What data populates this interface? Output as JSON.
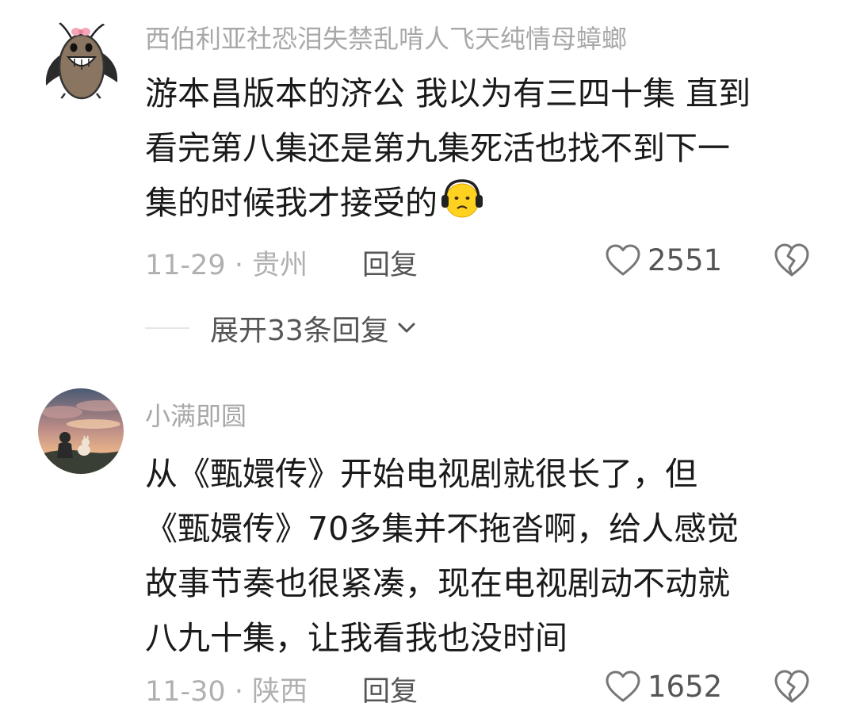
{
  "comments": [
    {
      "username": "西伯利亚社恐泪失禁乱啃人飞天纯情母蟑螂",
      "avatar_icon": "cockroach-cartoon-avatar",
      "content_lines": [
        "游本昌版本的济公 我以为有三四十集 直到",
        "看完第八集还是第九集死活也找不到下一",
        "集的时候我才接受的"
      ],
      "emoji_icon": "headphones-sad-face-emoji",
      "date": "11-29",
      "location": "贵州",
      "reply_label": "回复",
      "like_count": "2551",
      "expand_label": "展开33条回复"
    },
    {
      "username": "小满即圆",
      "avatar_icon": "sunset-child-dog-avatar",
      "content_lines": [
        "从《甄嬛传》开始电视剧就很长了，但",
        "《甄嬛传》70多集并不拖沓啊，给人感觉",
        "故事节奏也很紧凑，现在电视剧动不动就",
        "八九十集，让我看我也没时间"
      ],
      "date": "11-30",
      "location": "陕西",
      "reply_label": "回复",
      "like_count": "1652"
    }
  ],
  "meta_separator": " · ",
  "colors": {
    "text_primary": "#1a1a1a",
    "text_secondary": "#a8a8a8",
    "text_action": "#555555",
    "divider": "#e6e6e6"
  }
}
